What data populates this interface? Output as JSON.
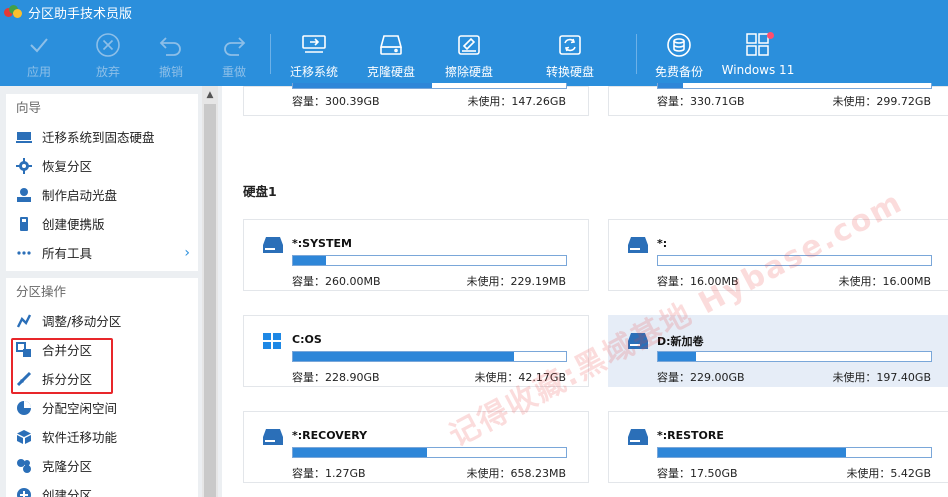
{
  "app": {
    "title": "分区助手技术员版"
  },
  "toolbar": {
    "apply": "应用",
    "discard": "放弃",
    "undo": "撤销",
    "redo": "重做",
    "migrate_os": "迁移系统",
    "clone_disk": "克隆硬盘",
    "wipe_disk": "擦除硬盘",
    "convert_disk": "转换硬盘",
    "free_backup": "免费备份",
    "windows11": "Windows 11"
  },
  "sidebar": {
    "wizard": {
      "title": "向导",
      "items": [
        {
          "label": "迁移系统到固态硬盘",
          "icon": "ssd-migrate-icon"
        },
        {
          "label": "恢复分区",
          "icon": "recover-icon"
        },
        {
          "label": "制作启动光盘",
          "icon": "boot-disc-icon"
        },
        {
          "label": "创建便携版",
          "icon": "portable-icon"
        },
        {
          "label": "所有工具",
          "icon": "more-dots-icon"
        }
      ]
    },
    "ops": {
      "title": "分区操作",
      "items": [
        {
          "label": "调整/移动分区",
          "icon": "resize-icon"
        },
        {
          "label": "合并分区",
          "icon": "merge-icon"
        },
        {
          "label": "拆分分区",
          "icon": "split-icon"
        },
        {
          "label": "分配空闲空间",
          "icon": "allocate-icon"
        },
        {
          "label": "软件迁移功能",
          "icon": "app-migrate-icon"
        },
        {
          "label": "克隆分区",
          "icon": "clone-icon"
        },
        {
          "label": "创建分区",
          "icon": "create-icon"
        }
      ]
    }
  },
  "main": {
    "disk1_label": "硬盘1",
    "top_cards": [
      {
        "capacity": "容量：300.39GB",
        "unused": "未使用：147.26GB",
        "used_fraction": 0.51
      },
      {
        "capacity": "容量：330.71GB",
        "unused": "未使用：299.72GB",
        "used_fraction": 0.09
      }
    ],
    "partitions": [
      {
        "name": "*:SYSTEM",
        "capacity": "容量：260.00MB",
        "unused": "未使用：229.19MB",
        "used_fraction": 0.12,
        "icon": "drive-icon"
      },
      {
        "name": "*:",
        "capacity": "容量：16.00MB",
        "unused": "未使用：16.00MB",
        "used_fraction": 0.0,
        "icon": "drive-icon"
      },
      {
        "name": "C:OS",
        "capacity": "容量：228.90GB",
        "unused": "未使用：42.17GB",
        "used_fraction": 0.81,
        "icon": "windows-icon"
      },
      {
        "name": "D:新加卷",
        "capacity": "容量：229.00GB",
        "unused": "未使用：197.40GB",
        "used_fraction": 0.14,
        "icon": "drive-icon"
      },
      {
        "name": "*:RECOVERY",
        "capacity": "容量：1.27GB",
        "unused": "未使用：658.23MB",
        "used_fraction": 0.49,
        "icon": "drive-icon"
      },
      {
        "name": "*:RESTORE",
        "capacity": "容量：17.50GB",
        "unused": "未使用：5.42GB",
        "used_fraction": 0.69,
        "icon": "drive-icon"
      }
    ]
  },
  "watermark": "记得收藏:黑域基地 Hybase.com",
  "colors": {
    "accent": "#2b8fdc",
    "bar_fill": "#2e86d8",
    "highlight_box": "#e8262a"
  }
}
